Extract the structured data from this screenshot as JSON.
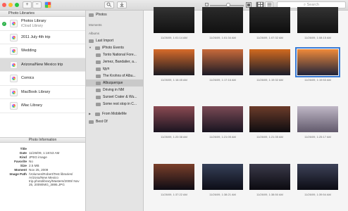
{
  "toolbar": {
    "add_label": "+",
    "remove_label": "−",
    "search_placeholder": "Search",
    "zoom_level": 0.5
  },
  "libraries": {
    "header": "Photo Libraries",
    "items": [
      {
        "label": "Photos Library",
        "sub": "iCloud Library",
        "checked": true,
        "selected": false
      },
      {
        "label": "2011 July 4th trip",
        "selected": false
      },
      {
        "label": "Wedding",
        "selected": false
      },
      {
        "label": "Arizona/New Mexico trip",
        "selected": true
      },
      {
        "label": "Comics",
        "selected": false
      },
      {
        "label": "MacBook Library",
        "selected": false
      },
      {
        "label": "iMac Library",
        "selected": false
      }
    ]
  },
  "info": {
    "header": "Photo Information",
    "rows": [
      {
        "k": "Title",
        "v": ""
      },
      {
        "k": "Date",
        "v": "11/26/09, 1:18:53 AM"
      },
      {
        "k": "Kind",
        "v": "JPEG image"
      },
      {
        "k": "Favorite",
        "v": "No"
      },
      {
        "k": "Size",
        "k2": "",
        "v": "2.5 MB"
      },
      {
        "k": "Moment",
        "v": "Nov 25, 2009"
      },
      {
        "k": "Image Path",
        "v": "/Volumes/Robert/Test libraries/ Arizona/New Mexico trip.photolibrary/Masters/2009/ Nov 25, 2009/IMG_3895.JPG"
      }
    ]
  },
  "events": {
    "photos_label": "Photos",
    "moments_label": "Moments",
    "albums_label": "Albums",
    "last_import": "Last Import",
    "iphoto_events": "iPhoto Events",
    "items": [
      {
        "label": "Tonto National Fore...",
        "selected": false
      },
      {
        "label": "Jemez, Bandalier, a...",
        "selected": false
      },
      {
        "label": "tgyn",
        "selected": false
      },
      {
        "label": "The Krohns of Albu...",
        "selected": false
      },
      {
        "label": "Albuquerque",
        "selected": true
      },
      {
        "label": "Driving in NM",
        "selected": false
      },
      {
        "label": "Sunset Crater & Wu...",
        "selected": false
      },
      {
        "label": "Some rest stop in C...",
        "selected": false
      }
    ],
    "from_mobileme": "From MobileMe",
    "best_of": "Best Of"
  },
  "photos": [
    {
      "cap": "11/26/09, 1:01:14 AM",
      "colors": [
        "#333",
        "#111"
      ]
    },
    {
      "cap": "11/26/09, 1:01:34 AM",
      "colors": [
        "#2a2a2a",
        "#111"
      ]
    },
    {
      "cap": "11/26/09, 1:07:32 AM",
      "colors": [
        "#2d2d2d",
        "#0e0e0e"
      ]
    },
    {
      "cap": "11/26/09, 1:08:15 AM",
      "colors": [
        "#333",
        "#121212"
      ]
    },
    {
      "cap": "11/26/09, 1:16:45 AM",
      "colors": [
        "#d86b2a",
        "#1a1a22"
      ]
    },
    {
      "cap": "11/26/09, 1:17:16 AM",
      "colors": [
        "#c96a3a",
        "#1b1a26"
      ]
    },
    {
      "cap": "11/26/09, 1:19:32 AM",
      "colors": [
        "#d26a1f",
        "#1a1c2a"
      ]
    },
    {
      "cap": "11/26/09, 1:19:53 AM",
      "colors": [
        "#f08a3a",
        "#20233a"
      ],
      "selected": true
    },
    {
      "cap": "11/26/09, 1:20:38 AM",
      "colors": [
        "#8b4a52",
        "#1a1420"
      ]
    },
    {
      "cap": "11/26/09, 1:21:05 AM",
      "colors": [
        "#7a4a55",
        "#181420"
      ]
    },
    {
      "cap": "11/26/09, 1:21:35 AM",
      "colors": [
        "#6c3c2a",
        "#0e0c10"
      ]
    },
    {
      "cap": "11/26/09, 1:25:17 AM",
      "colors": [
        "#bfb7c6",
        "#625a6c"
      ]
    },
    {
      "cap": "11/26/09, 1:37:22 AM",
      "colors": [
        "#7a3f2a",
        "#0d0b14"
      ]
    },
    {
      "cap": "11/26/09, 1:38:21 AM",
      "colors": [
        "#364058",
        "#0c0d16"
      ]
    },
    {
      "cap": "11/26/09, 1:38:50 AM",
      "colors": [
        "#3b3a4a",
        "#0b0a10"
      ]
    },
    {
      "cap": "11/26/09, 1:39:54 AM",
      "colors": [
        "#3d4258",
        "#0c0c14"
      ]
    }
  ]
}
